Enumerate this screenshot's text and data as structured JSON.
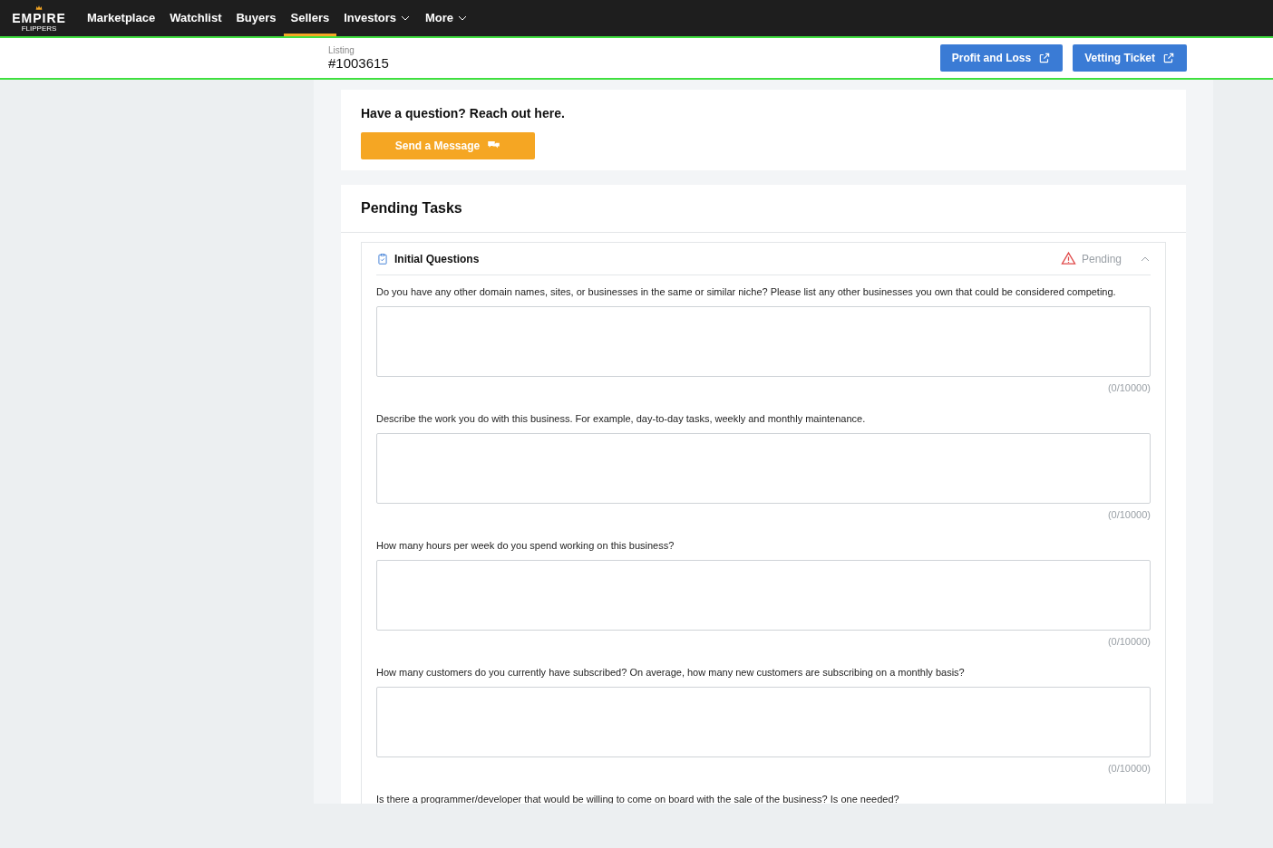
{
  "brand": {
    "name": "EMPIRE",
    "sub": "FLIPPERS"
  },
  "nav": [
    {
      "label": "Marketplace",
      "selected": false,
      "dropdown": false
    },
    {
      "label": "Watchlist",
      "selected": false,
      "dropdown": false
    },
    {
      "label": "Buyers",
      "selected": false,
      "dropdown": false
    },
    {
      "label": "Sellers",
      "selected": true,
      "dropdown": false
    },
    {
      "label": "Investors",
      "selected": false,
      "dropdown": true
    },
    {
      "label": "More",
      "selected": false,
      "dropdown": true
    }
  ],
  "listing": {
    "label": "Listing",
    "number": "#1003615"
  },
  "header_buttons": [
    "Profit and Loss",
    "Vetting Ticket"
  ],
  "contact": {
    "prompt": "Have a question? Reach out here.",
    "button": "Send a Message"
  },
  "pending": {
    "title": "Pending Tasks",
    "task": {
      "title": "Initial Questions",
      "status": "Pending",
      "expanded": true,
      "questions": [
        {
          "label": "Do you have any other domain names, sites, or businesses in the same or similar niche? Please list any other businesses you own that could be considered competing.",
          "counter": "(0/10000)"
        },
        {
          "label": "Describe the work you do with this business. For example, day-to-day tasks, weekly and monthly maintenance.",
          "counter": "(0/10000)"
        },
        {
          "label": "How many hours per week do you spend working on this business?",
          "counter": "(0/10000)"
        },
        {
          "label": "How many customers do you currently have subscribed? On average, how many new customers are subscribing on a monthly basis?",
          "counter": "(0/10000)"
        },
        {
          "label": "Is there a programmer/developer that would be willing to come on board with the sale of the business? Is one needed?"
        }
      ]
    }
  }
}
